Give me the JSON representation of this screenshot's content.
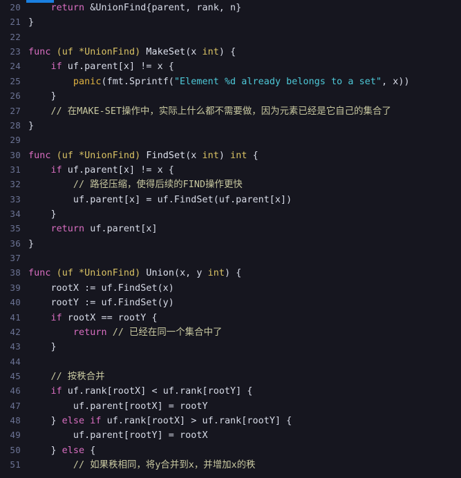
{
  "editor": {
    "language": "go",
    "theme_background": "#16161f",
    "gutter_color": "#6b7394",
    "top_bar_color": "#1a7fe0",
    "first_line": 20,
    "last_line": 51
  },
  "colors": {
    "keyword": "#d96ec1",
    "type": "#d9c264",
    "function": "#dfe3ef",
    "builtin": "#e0b341",
    "string": "#4ec9d8",
    "comment": "#c8c8a0",
    "plain": "#d8dce8",
    "linenumber": "#6b7394",
    "background": "#16161f",
    "accent": "#1a7fe0"
  },
  "lines": [
    {
      "n": "20",
      "tokens": [
        {
          "t": "    ",
          "c": "plain"
        },
        {
          "t": "return",
          "c": "kw"
        },
        {
          "t": " &UnionFind{parent, rank, n}",
          "c": "plain"
        }
      ]
    },
    {
      "n": "21",
      "tokens": [
        {
          "t": "}",
          "c": "plain"
        }
      ]
    },
    {
      "n": "22",
      "tokens": [
        {
          "t": "",
          "c": "plain"
        }
      ]
    },
    {
      "n": "23",
      "tokens": [
        {
          "t": "func",
          "c": "kw"
        },
        {
          "t": " ",
          "c": "plain"
        },
        {
          "t": "(uf *UnionFind)",
          "c": "recv"
        },
        {
          "t": " ",
          "c": "plain"
        },
        {
          "t": "MakeSet",
          "c": "fn"
        },
        {
          "t": "(x ",
          "c": "plain"
        },
        {
          "t": "int",
          "c": "type"
        },
        {
          "t": ") {",
          "c": "plain"
        }
      ]
    },
    {
      "n": "24",
      "tokens": [
        {
          "t": "    ",
          "c": "plain"
        },
        {
          "t": "if",
          "c": "kw"
        },
        {
          "t": " uf.parent[x] != x {",
          "c": "plain"
        }
      ]
    },
    {
      "n": "25",
      "tokens": [
        {
          "t": "        ",
          "c": "plain"
        },
        {
          "t": "panic",
          "c": "builtin"
        },
        {
          "t": "(fmt.Sprintf(",
          "c": "plain"
        },
        {
          "t": "\"Element %d already belongs to a set\"",
          "c": "str"
        },
        {
          "t": ", x))",
          "c": "plain"
        }
      ]
    },
    {
      "n": "26",
      "tokens": [
        {
          "t": "    }",
          "c": "plain"
        }
      ]
    },
    {
      "n": "27",
      "tokens": [
        {
          "t": "    ",
          "c": "plain"
        },
        {
          "t": "// 在MAKE-SET操作中，实际上什么都不需要做，因为元素已经是它自己的集合了",
          "c": "cmt"
        }
      ]
    },
    {
      "n": "28",
      "tokens": [
        {
          "t": "}",
          "c": "plain"
        }
      ]
    },
    {
      "n": "29",
      "tokens": [
        {
          "t": "",
          "c": "plain"
        }
      ]
    },
    {
      "n": "30",
      "tokens": [
        {
          "t": "func",
          "c": "kw"
        },
        {
          "t": " ",
          "c": "plain"
        },
        {
          "t": "(uf *UnionFind)",
          "c": "recv"
        },
        {
          "t": " ",
          "c": "plain"
        },
        {
          "t": "FindSet",
          "c": "fn"
        },
        {
          "t": "(x ",
          "c": "plain"
        },
        {
          "t": "int",
          "c": "type"
        },
        {
          "t": ") ",
          "c": "plain"
        },
        {
          "t": "int",
          "c": "type"
        },
        {
          "t": " {",
          "c": "plain"
        }
      ]
    },
    {
      "n": "31",
      "tokens": [
        {
          "t": "    ",
          "c": "plain"
        },
        {
          "t": "if",
          "c": "kw"
        },
        {
          "t": " uf.parent[x] != x {",
          "c": "plain"
        }
      ]
    },
    {
      "n": "32",
      "tokens": [
        {
          "t": "        ",
          "c": "plain"
        },
        {
          "t": "// 路径压缩，使得后续的FIND操作更快",
          "c": "cmt"
        }
      ]
    },
    {
      "n": "33",
      "tokens": [
        {
          "t": "        uf.parent[x] = uf.FindSet(uf.parent[x])",
          "c": "plain"
        }
      ]
    },
    {
      "n": "34",
      "tokens": [
        {
          "t": "    }",
          "c": "plain"
        }
      ]
    },
    {
      "n": "35",
      "tokens": [
        {
          "t": "    ",
          "c": "plain"
        },
        {
          "t": "return",
          "c": "kw"
        },
        {
          "t": " uf.parent[x]",
          "c": "plain"
        }
      ]
    },
    {
      "n": "36",
      "tokens": [
        {
          "t": "}",
          "c": "plain"
        }
      ]
    },
    {
      "n": "37",
      "tokens": [
        {
          "t": "",
          "c": "plain"
        }
      ]
    },
    {
      "n": "38",
      "tokens": [
        {
          "t": "func",
          "c": "kw"
        },
        {
          "t": " ",
          "c": "plain"
        },
        {
          "t": "(uf *UnionFind)",
          "c": "recv"
        },
        {
          "t": " ",
          "c": "plain"
        },
        {
          "t": "Union",
          "c": "fn"
        },
        {
          "t": "(x, y ",
          "c": "plain"
        },
        {
          "t": "int",
          "c": "type"
        },
        {
          "t": ") {",
          "c": "plain"
        }
      ]
    },
    {
      "n": "39",
      "tokens": [
        {
          "t": "    rootX := uf.FindSet(x)",
          "c": "plain"
        }
      ]
    },
    {
      "n": "40",
      "tokens": [
        {
          "t": "    rootY := uf.FindSet(y)",
          "c": "plain"
        }
      ]
    },
    {
      "n": "41",
      "tokens": [
        {
          "t": "    ",
          "c": "plain"
        },
        {
          "t": "if",
          "c": "kw"
        },
        {
          "t": " rootX == rootY {",
          "c": "plain"
        }
      ]
    },
    {
      "n": "42",
      "tokens": [
        {
          "t": "        ",
          "c": "plain"
        },
        {
          "t": "return",
          "c": "kw"
        },
        {
          "t": " ",
          "c": "plain"
        },
        {
          "t": "// 已经在同一个集合中了",
          "c": "cmt"
        }
      ]
    },
    {
      "n": "43",
      "tokens": [
        {
          "t": "    }",
          "c": "plain"
        }
      ]
    },
    {
      "n": "44",
      "tokens": [
        {
          "t": "",
          "c": "plain"
        }
      ]
    },
    {
      "n": "45",
      "tokens": [
        {
          "t": "    ",
          "c": "plain"
        },
        {
          "t": "// 按秩合并",
          "c": "cmt"
        }
      ]
    },
    {
      "n": "46",
      "tokens": [
        {
          "t": "    ",
          "c": "plain"
        },
        {
          "t": "if",
          "c": "kw"
        },
        {
          "t": " uf.rank[rootX] < uf.rank[rootY] {",
          "c": "plain"
        }
      ]
    },
    {
      "n": "47",
      "tokens": [
        {
          "t": "        uf.parent[rootX] = rootY",
          "c": "plain"
        }
      ]
    },
    {
      "n": "48",
      "tokens": [
        {
          "t": "    } ",
          "c": "plain"
        },
        {
          "t": "else",
          "c": "kw"
        },
        {
          "t": " ",
          "c": "plain"
        },
        {
          "t": "if",
          "c": "kw"
        },
        {
          "t": " uf.rank[rootX] > uf.rank[rootY] {",
          "c": "plain"
        }
      ]
    },
    {
      "n": "49",
      "tokens": [
        {
          "t": "        uf.parent[rootY] = rootX",
          "c": "plain"
        }
      ]
    },
    {
      "n": "50",
      "tokens": [
        {
          "t": "    } ",
          "c": "plain"
        },
        {
          "t": "else",
          "c": "kw"
        },
        {
          "t": " {",
          "c": "plain"
        }
      ]
    },
    {
      "n": "51",
      "tokens": [
        {
          "t": "        ",
          "c": "plain"
        },
        {
          "t": "// 如果秩相同，将y合并到x，并增加x的秩",
          "c": "cmt"
        }
      ]
    }
  ]
}
